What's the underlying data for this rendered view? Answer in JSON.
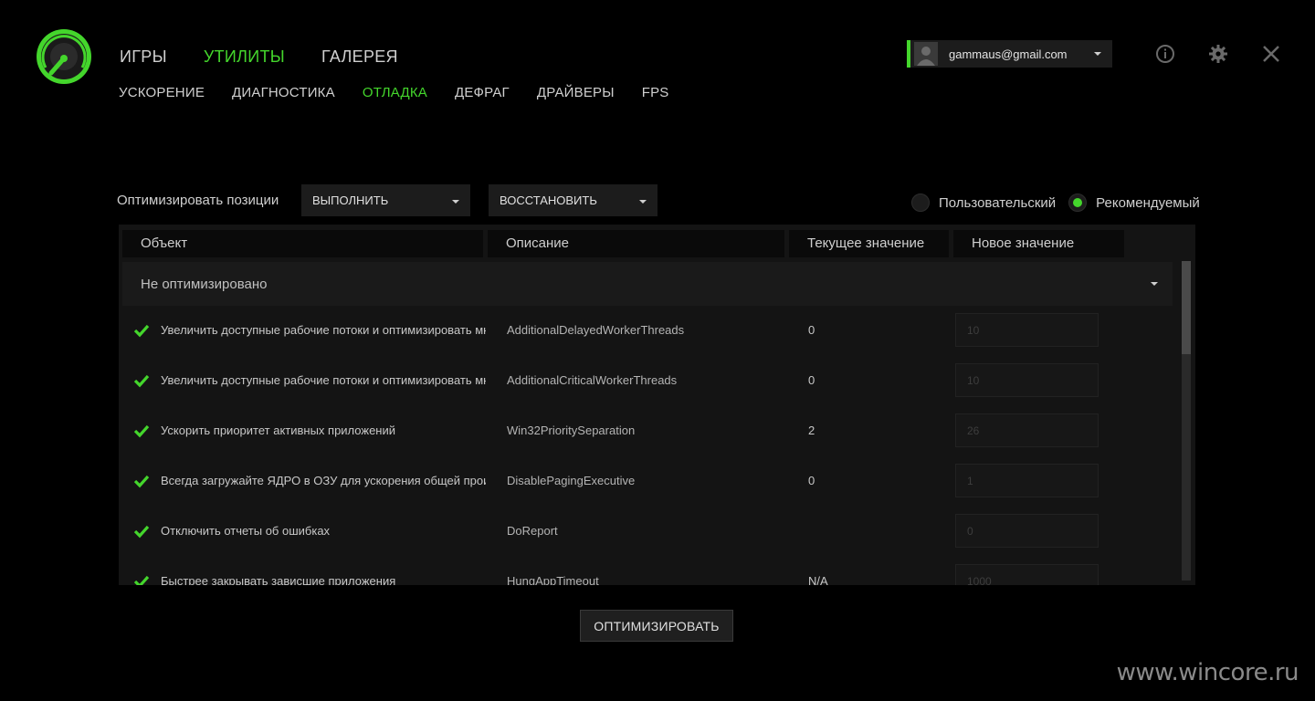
{
  "nav": {
    "main": [
      {
        "label": "ИГРЫ",
        "active": false
      },
      {
        "label": "УТИЛИТЫ",
        "active": true
      },
      {
        "label": "ГАЛЕРЕЯ",
        "active": false
      }
    ],
    "sub": [
      {
        "label": "УСКОРЕНИЕ",
        "active": false
      },
      {
        "label": "ДИАГНОСТИКА",
        "active": false
      },
      {
        "label": "ОТЛАДКА",
        "active": true
      },
      {
        "label": "ДЕФРАГ",
        "active": false
      },
      {
        "label": "ДРАЙВЕРЫ",
        "active": false
      },
      {
        "label": "FPS",
        "active": false
      }
    ]
  },
  "account": {
    "email": "gammaus@gmail.com"
  },
  "toolbar": {
    "optimize_label": "Оптимизировать позиции",
    "execute_dropdown": "ВЫПОЛНИТЬ",
    "restore_dropdown": "ВОССТАНОВИТЬ",
    "mode_custom": "Пользовательский",
    "mode_recommended": "Рекомендуемый",
    "selected_mode": "recommended"
  },
  "table": {
    "headers": {
      "object": "Объект",
      "description": "Описание",
      "current": "Текущее значение",
      "new": "Новое значение"
    },
    "group_label": "Не оптимизировано",
    "rows": [
      {
        "object": "Увеличить доступные рабочие потоки и оптимизировать многозадачность",
        "description": "AdditionalDelayedWorkerThreads",
        "current": "0",
        "new": "10"
      },
      {
        "object": "Увеличить доступные рабочие потоки и оптимизировать многозадачность",
        "description": "AdditionalCriticalWorkerThreads",
        "current": "0",
        "new": "10"
      },
      {
        "object": "Ускорить приоритет активных приложений",
        "description": "Win32PrioritySeparation",
        "current": "2",
        "new": "26"
      },
      {
        "object": "Всегда загружайте ЯДРО в ОЗУ для ускорения общей производительности",
        "description": "DisablePagingExecutive",
        "current": "0",
        "new": "1"
      },
      {
        "object": "Отключить отчеты об ошибках",
        "description": "DoReport",
        "current": "",
        "new": "0"
      },
      {
        "object": "Быстрее закрывать зависшие приложения",
        "description": "HungAppTimeout",
        "current": "N/A",
        "new": "1000"
      }
    ]
  },
  "optimize_button": "ОПТИМИЗИРОВАТЬ",
  "watermark": "www.wincore.ru",
  "colors": {
    "accent": "#44d62c",
    "background": "#000000",
    "panel": "#141414"
  }
}
